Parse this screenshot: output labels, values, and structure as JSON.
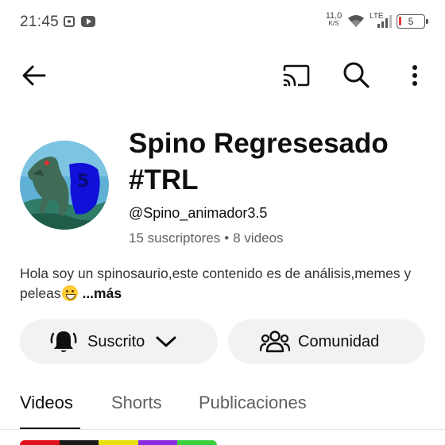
{
  "status_bar": {
    "time": "21:45",
    "net_speed_value": "11,0",
    "net_speed_unit": "K/S",
    "network_type": "LTE",
    "battery_level": "5",
    "icons": [
      "screen-record-icon",
      "youtube-icon",
      "wifi-icon",
      "signal-icon",
      "battery-icon"
    ]
  },
  "top_bar": {
    "icons": [
      "back-arrow-icon",
      "cast-icon",
      "search-icon",
      "more-vert-icon"
    ]
  },
  "channel": {
    "name_line1": "Spino Regresesado",
    "name_line2": "#TRL",
    "handle": "@Spino_animador3.5",
    "subscribers": "15 suscriptores",
    "separator": "•",
    "videos": "8 videos",
    "description": "Hola soy un spinosaurio,este contenido es de análisis,memes y peleas",
    "more_link": "...más"
  },
  "actions": {
    "subscribe_label": "Suscrito",
    "community_label": "Comunidad"
  },
  "tabs": [
    {
      "label": "Videos",
      "active": true
    },
    {
      "label": "Shorts",
      "active": false
    },
    {
      "label": "Publicaciones",
      "active": false
    }
  ],
  "colors": {
    "text_primary": "#0f0f0f",
    "text_secondary": "#606060",
    "pill_background": "#f2f2f2",
    "battery_low": "#e53935"
  }
}
